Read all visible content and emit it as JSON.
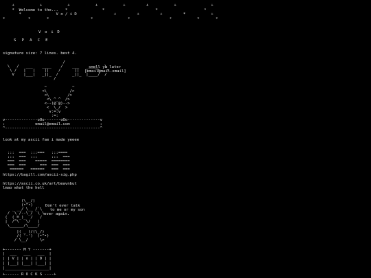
{
  "header": {
    "star_field": [
      "    +           +           +           +           +         +           +               +",
      "    *  Welcome to the...   *               *                      *                    *",
      "       *               V o / i D                +         +         +         *           +",
      "*          *       *                  *               *                 *           *       *"
    ]
  },
  "void_title": "V o i D",
  "space_title": "S P A C E",
  "signature_note": "signature size: 7 lines. best 4.",
  "sig_art": [
    "                          /",
    "  \\   /   ___    ____    /    ___    ____   \\",
    "   \\ /   |   |    ||    /      ||   |    \\   >",
    "    V    |___|   _||_  /      _||_  |____/  /",
    "                      /"
  ],
  "sig_contact": [
    "smell ya later",
    "[email@mail.email]"
  ],
  "face_art": [
    "                  ~           ~",
    "                 <\\          />",
    "                  <\\        />",
    "                   <\\ ^_^  />",
    "                  <--(@ @)-->",
    "                   <  \\_/  >",
    "                    v:=:v",
    "                     :=:",
    "v--------------oOo-------oOo--------------v",
    ":             email@email.com             :",
    "^-----------------------------------------^"
  ],
  "look_text": "look at my ascii fae i made yeeee",
  "block_art": [
    "  :::  ===  :::===   :::====",
    "  :::  ===  :::      :::  ===",
    "  ===  ===    =====  ========",
    "  ===  ===      ===  ===  ===",
    "   ======   ======   ===  ==="
  ],
  "links": [
    "https://bagill.com/ascii-sig.php",
    "",
    "https://ascii.co.uk/art/beavnbut",
    "lmao what the hell"
  ],
  "beaver_art": [
    "        (\\__/)",
    "        (•^•)",
    "      __/ \\__ /`\\",
    "  / `\\_/--\\_/ `\\ \\",
    " (  (_=_)_  /   /",
    " |  /^\\   \\/   |",
    "  \\______/\\____/",
    "      |( _ )/(\\_/)",
    "      /( '-')  (•^•)",
    "     / \\__/     \\>"
  ],
  "beaver_caption": [
    "Don't ever talk",
    "  to me or my son",
    "ever again."
  ],
  "my_void_art": [
    "+------- M Y -------+",
    "|  ___   ___   ___  |",
    "| | V | | o | | D | |",
    "| |___| |___| |___| |",
    "|___________________|",
    "+------ R O C K S ----+"
  ]
}
